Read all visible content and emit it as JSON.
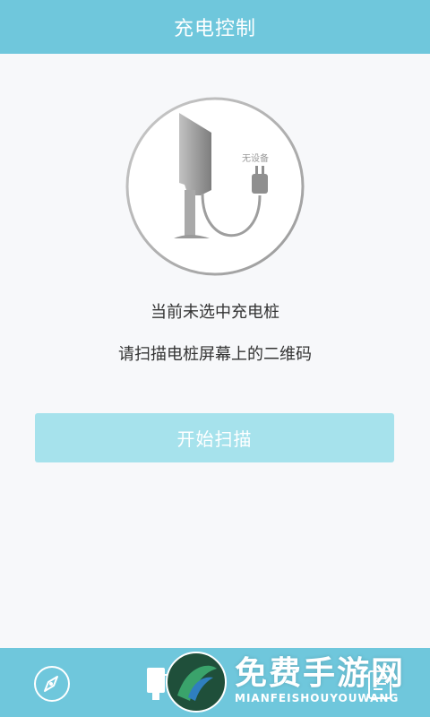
{
  "header": {
    "title": "充电控制"
  },
  "illustration": {
    "device_status_label": "无设备",
    "icon": "charging-pile-illustration"
  },
  "status": {
    "line1": "当前未选中充电桩",
    "line2": "请扫描电桩屏幕上的二维码"
  },
  "actions": {
    "scan_label": "开始扫描"
  },
  "bottom_nav": {
    "items": [
      {
        "icon": "compass-icon"
      },
      {
        "icon": "charging-pile-icon"
      },
      {
        "icon": "document-icon"
      }
    ]
  },
  "watermark": {
    "title": "免费手游网",
    "subtitle": "MIANFEISHOUYOUWANG"
  },
  "colors": {
    "accent": "#6fc7dc",
    "button": "#a6e2ec",
    "background": "#f7f8fa"
  }
}
